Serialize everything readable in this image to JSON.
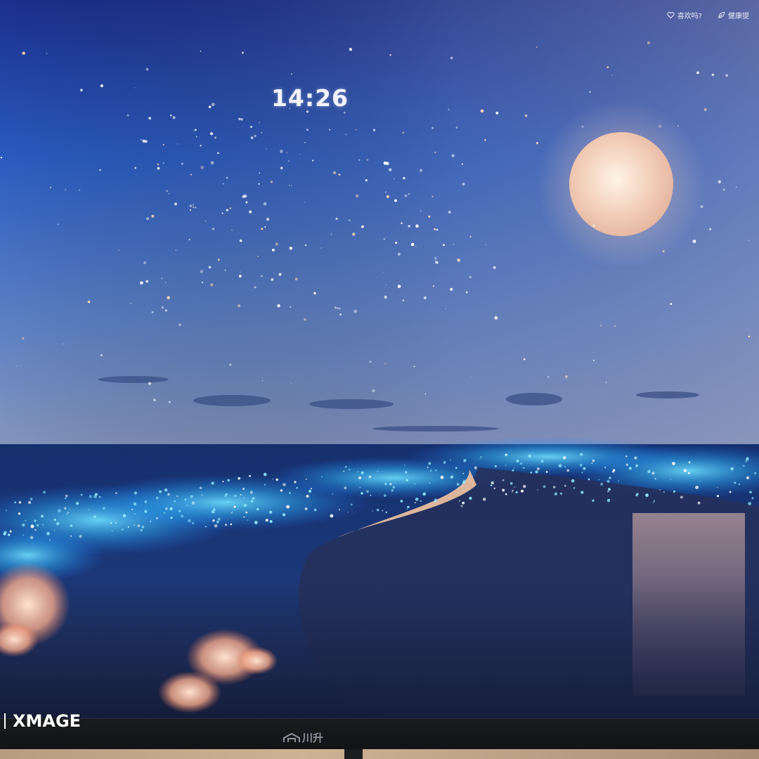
{
  "screen": {
    "clock": "14:26",
    "top_right": {
      "like_label": "喜欢吗?",
      "health_label": "健康提"
    }
  },
  "monitor": {
    "brand": "川升"
  },
  "watermark": {
    "text": "XMAGE"
  },
  "colors": {
    "sky_top": "#1f3f9e",
    "sky_horizon": "#7f93bf",
    "sea_glow": "#3fc8ff",
    "moon": "#f6d9c4",
    "sand": "#2c3552"
  },
  "icons": [
    "heart-icon",
    "leaf-icon",
    "monitor-logo-icon"
  ]
}
